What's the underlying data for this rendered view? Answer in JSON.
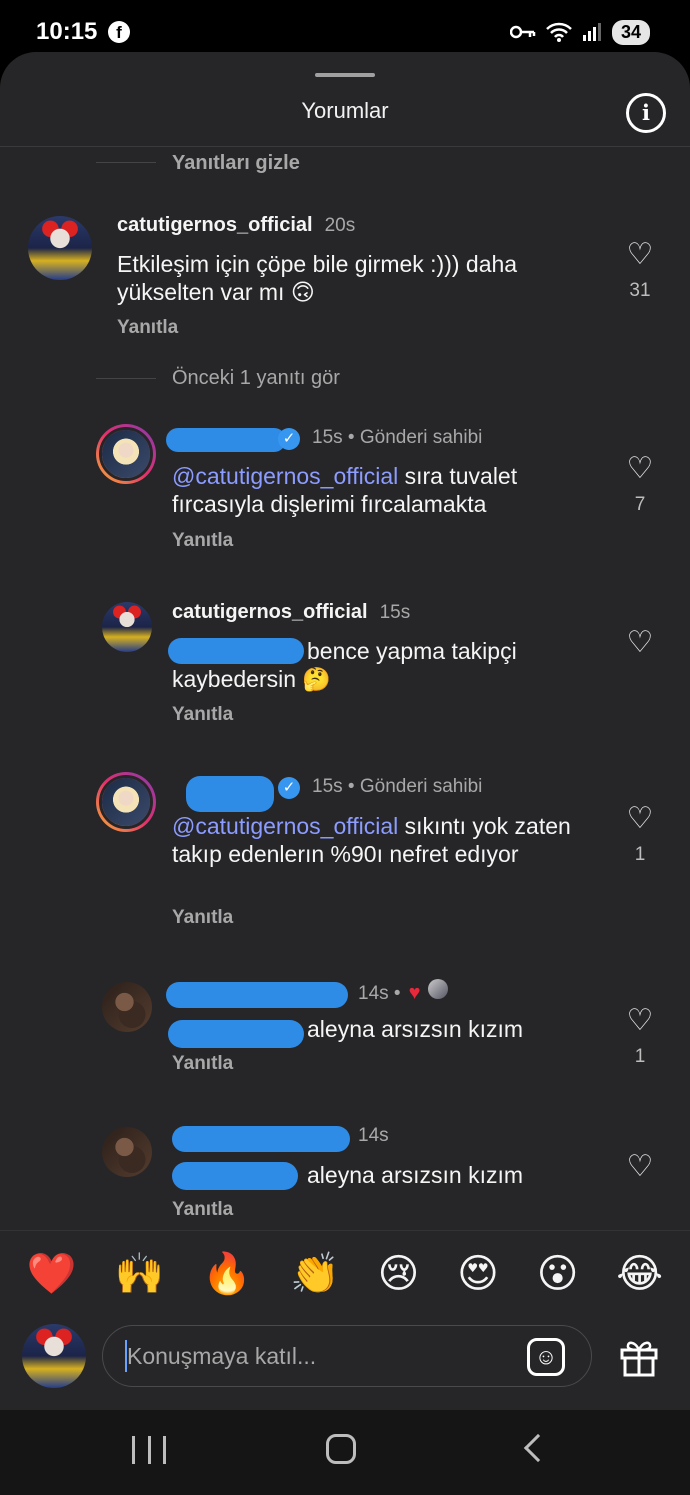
{
  "status_bar": {
    "time": "10:15",
    "facebook_icon": "facebook-icon",
    "battery": "34"
  },
  "sheet": {
    "title": "Yorumlar"
  },
  "thread": {
    "hide_replies": "Yanıtları gizle",
    "see_previous": "Önceki 1 yanıtı gör"
  },
  "comments": [
    {
      "username": "catutigernos_official",
      "time": "20s",
      "text": "Etkileşim için çöpe bile girmek :))) daha yükselten var mı 🙃",
      "reply": "Yanıtla",
      "likes": "31"
    },
    {
      "time": "15s • Gönderi sahibi",
      "mention": "@catutigernos_official",
      "text": " sıra tuvalet fırcasıyla dişlerimi fırcalamakta",
      "reply": "Yanıtla",
      "likes": "7"
    },
    {
      "username": "catutigernos_official",
      "time": "15s",
      "text": "bence yapma takipçi kaybedersin 🤔",
      "reply": "Yanıtla",
      "likes": ""
    },
    {
      "time": "15s • Gönderi sahibi",
      "mention": "@catutigernos_official",
      "text": " sıkıntı yok zaten takıp edenlerın %90ı nefret edıyor",
      "reply": "Yanıtla",
      "likes": "1"
    },
    {
      "time": "14s •",
      "text": "aleyna arsızsın kızım",
      "reply": "Yanıtla",
      "likes": "1"
    },
    {
      "time": "14s",
      "text": "aleyna arsızsın kızım",
      "reply": "Yanıtla",
      "likes": ""
    }
  ],
  "reactions": [
    "❤️",
    "🙌",
    "🔥",
    "👏",
    "😢",
    "😍",
    "😮",
    "😂"
  ],
  "composer": {
    "placeholder": "Konuşmaya katıl..."
  },
  "icons": {
    "heart": "heart-icon",
    "info": "info-icon",
    "sticker": "sticker-icon",
    "gift": "gift-icon"
  }
}
